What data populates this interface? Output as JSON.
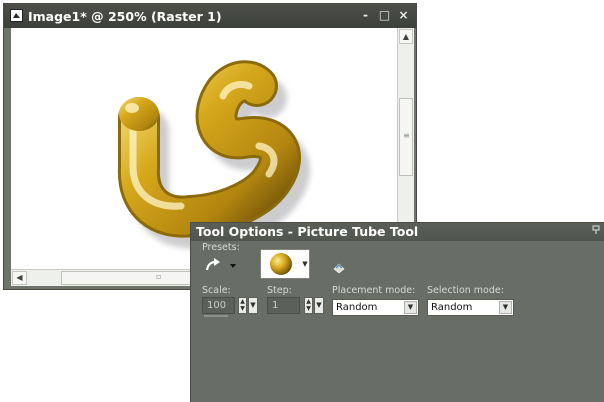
{
  "image_window": {
    "title": "Image1* @ 250% (Raster 1)",
    "controls": {
      "minimize": "-",
      "restore": "□",
      "close": "×"
    },
    "hscroll_mark": "▫",
    "vscroll_mark": "≡"
  },
  "tool_options": {
    "title": "Tool Options - Picture Tube Tool",
    "presets_label": "Presets:",
    "scale": {
      "label": "Scale:",
      "value": "100"
    },
    "step": {
      "label": "Step:",
      "value": "1"
    },
    "placement_mode": {
      "label": "Placement mode:",
      "value": "Random"
    },
    "selection_mode": {
      "label": "Selection mode:",
      "value": "Random"
    }
  },
  "colors": {
    "panel_bg": "#686d66",
    "tube_gold": "#d7aa1c",
    "title_text": "#ffffff"
  },
  "icons": [
    "app-icon",
    "preset-arrow-icon",
    "tube-thumbnail-icon",
    "save-preset-icon",
    "pin-icon"
  ]
}
